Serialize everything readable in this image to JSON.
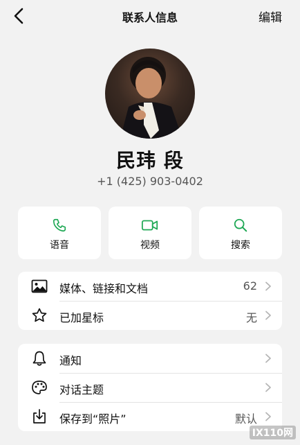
{
  "nav": {
    "title": "联系人信息",
    "edit_label": "编辑"
  },
  "contact": {
    "name": "民玮 段",
    "phone": "+1 (425) 903-0402"
  },
  "actions": [
    {
      "label": "语音",
      "icon": "phone-icon"
    },
    {
      "label": "视频",
      "icon": "video-icon"
    },
    {
      "label": "搜索",
      "icon": "search-icon"
    }
  ],
  "group1": [
    {
      "label": "媒体、链接和文档",
      "value": "62",
      "icon": "image-icon"
    },
    {
      "label": "已加星标",
      "value": "无",
      "icon": "star-icon"
    }
  ],
  "group2": [
    {
      "label": "通知",
      "value": "",
      "icon": "bell-icon"
    },
    {
      "label": "对话主题",
      "value": "",
      "icon": "palette-icon"
    },
    {
      "label": "保存到“照片”",
      "value": "默认",
      "icon": "save-to-photos-icon"
    }
  ],
  "watermark": {
    "text": "IX110网"
  },
  "colors": {
    "accent": "#1fa855",
    "background": "#f2f2f2",
    "card": "#ffffff"
  }
}
